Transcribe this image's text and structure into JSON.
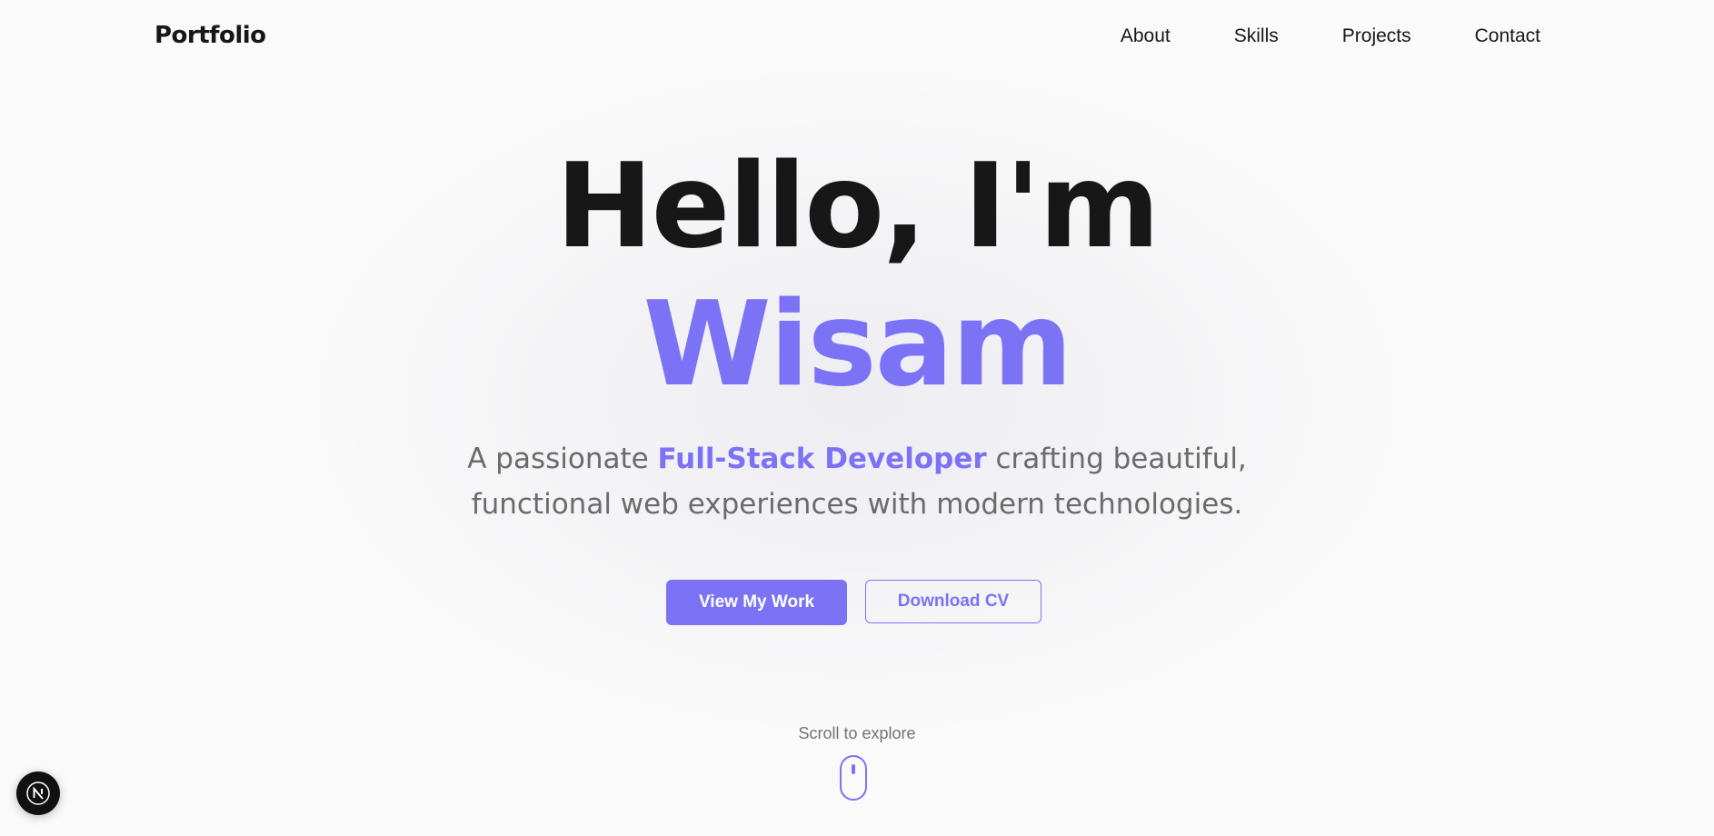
{
  "nav": {
    "logo": "Portfolio",
    "links": [
      {
        "label": "About"
      },
      {
        "label": "Skills"
      },
      {
        "label": "Projects"
      },
      {
        "label": "Contact"
      }
    ]
  },
  "hero": {
    "title_line1": "Hello, I'm",
    "title_line2": "Wisam",
    "subtitle_before": "A passionate ",
    "subtitle_highlight": "Full-Stack Developer",
    "subtitle_after": " crafting beautiful, functional web experiences with modern technologies.",
    "primary_button": "View My Work",
    "secondary_button": "Download CV"
  },
  "scroll": {
    "label": "Scroll to explore",
    "icon": "mouse-scroll-icon"
  },
  "dev_badge": {
    "icon": "nextjs-logo-icon"
  },
  "colors": {
    "accent": "#7c72f6",
    "text_dark": "#171717",
    "text_muted": "#6b6b6b",
    "background": "#fafafa"
  }
}
